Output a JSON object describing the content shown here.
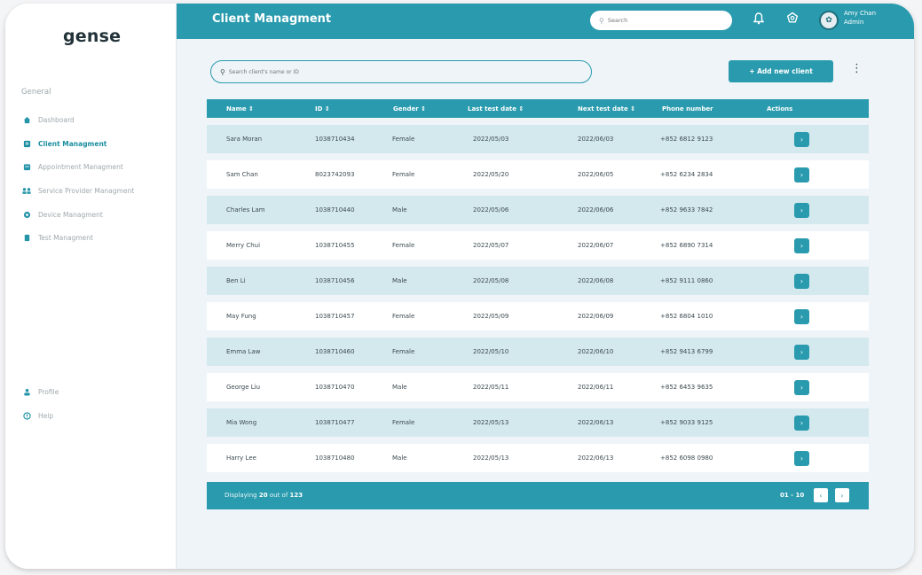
{
  "app": {
    "logo": "gense"
  },
  "sidebar": {
    "section_label": "General",
    "items": [
      {
        "label": "Dashboard",
        "icon": "home-icon",
        "active": false
      },
      {
        "label": "Client Managment",
        "icon": "client-icon",
        "active": true
      },
      {
        "label": "Appointment Managment",
        "icon": "calendar-icon",
        "active": false
      },
      {
        "label": "Service Provider Managment",
        "icon": "provider-icon",
        "active": false
      },
      {
        "label": "Device Managment",
        "icon": "device-icon",
        "active": false
      },
      {
        "label": "Test Managment",
        "icon": "test-icon",
        "active": false
      }
    ],
    "bottom_items": [
      {
        "label": "Profile",
        "icon": "user-icon"
      },
      {
        "label": "Help",
        "icon": "help-icon"
      }
    ]
  },
  "topbar": {
    "title": "Client Managment",
    "search_placeholder": "Search",
    "user_name": "Amy Chan",
    "user_role": "Admin"
  },
  "client_search": {
    "placeholder": "Search client's name or ID"
  },
  "add_button": {
    "label": "+ Add new client"
  },
  "table": {
    "headers": [
      "Name",
      "ID",
      "Gender",
      "Last test date",
      "Next test date",
      "Phone number",
      "Actions"
    ],
    "rows": [
      {
        "name": "Sara Moran",
        "id": "1038710434",
        "gender": "Female",
        "last": "2022/05/03",
        "next": "2022/06/03",
        "phone": "+852 6812 9123"
      },
      {
        "name": "Sam Chan",
        "id": "8023742093",
        "gender": "Female",
        "last": "2022/05/20",
        "next": "2022/06/05",
        "phone": "+852 6234 2834"
      },
      {
        "name": "Charles Lam",
        "id": "1038710440",
        "gender": "Male",
        "last": "2022/05/06",
        "next": "2022/06/06",
        "phone": "+852 9633 7842"
      },
      {
        "name": "Merry Chui",
        "id": "1038710455",
        "gender": "Female",
        "last": "2022/05/07",
        "next": "2022/06/07",
        "phone": "+852 6890 7314"
      },
      {
        "name": "Ben Li",
        "id": "1038710456",
        "gender": "Male",
        "last": "2022/05/08",
        "next": "2022/06/08",
        "phone": "+852 9111 0860"
      },
      {
        "name": "May Fung",
        "id": "1038710457",
        "gender": "Female",
        "last": "2022/05/09",
        "next": "2022/06/09",
        "phone": "+852 6804 1010"
      },
      {
        "name": "Emma Law",
        "id": "1038710460",
        "gender": "Female",
        "last": "2022/05/10",
        "next": "2022/06/10",
        "phone": "+852 9413 6799"
      },
      {
        "name": "George Liu",
        "id": "1038710470",
        "gender": "Male",
        "last": "2022/05/11",
        "next": "2022/06/11",
        "phone": "+852 6453 9635"
      },
      {
        "name": "Mia Wong",
        "id": "1038710477",
        "gender": "Female",
        "last": "2022/05/13",
        "next": "2022/06/13",
        "phone": "+852 9033 9125"
      },
      {
        "name": "Harry Lee",
        "id": "1038710480",
        "gender": "Male",
        "last": "2022/05/13",
        "next": "2022/06/13",
        "phone": "+852 6098 0980"
      }
    ]
  },
  "footer": {
    "displaying_prefix": "Displaying",
    "shown": "20",
    "out_of": "out of",
    "total": "123",
    "range": "01 - 10"
  },
  "colors": {
    "accent": "#2a9bae",
    "row_alt": "#d4e9ee",
    "background": "#eef4f8"
  }
}
